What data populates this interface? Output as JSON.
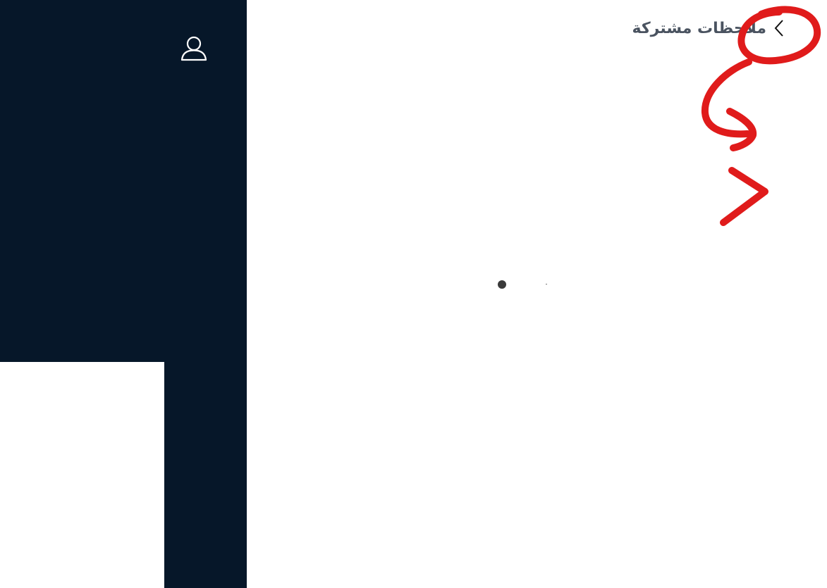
{
  "header": {
    "title": "ملاحظات مشتركة",
    "back_icon": "chevron-left-icon"
  },
  "sidebar": {
    "user_icon": "user-icon",
    "background_color": "#061729"
  },
  "main": {
    "loading_indicator": "loading-dot"
  },
  "annotation": {
    "color": "#e01b1b",
    "marks": [
      "circle",
      "curved-arrow",
      "chevron-right"
    ]
  }
}
